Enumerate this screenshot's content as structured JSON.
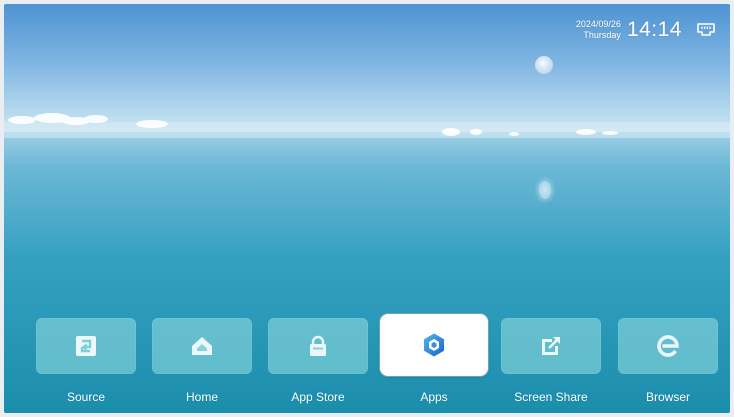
{
  "status": {
    "date": "2024/09/26",
    "weekday": "Thursday",
    "time": "14:14",
    "network_icon": "ethernet-icon"
  },
  "dock": {
    "selected": "Apps",
    "items": [
      {
        "label": "Source",
        "icon": "source-icon"
      },
      {
        "label": "Home",
        "icon": "home-icon"
      },
      {
        "label": "App Store",
        "icon": "app-store-icon"
      },
      {
        "label": "Apps",
        "icon": "apps-icon"
      },
      {
        "label": "Screen Share",
        "icon": "screen-share-icon"
      },
      {
        "label": "Browser",
        "icon": "browser-icon"
      }
    ]
  },
  "colors": {
    "sky_top": "#5c9fd6",
    "horizon": "#bde0ef",
    "sea": "#2b9bb9",
    "tile_bg": "#96dee0",
    "icon_tint": "#eaf8fb",
    "apps_accent": "#1e73c8"
  }
}
